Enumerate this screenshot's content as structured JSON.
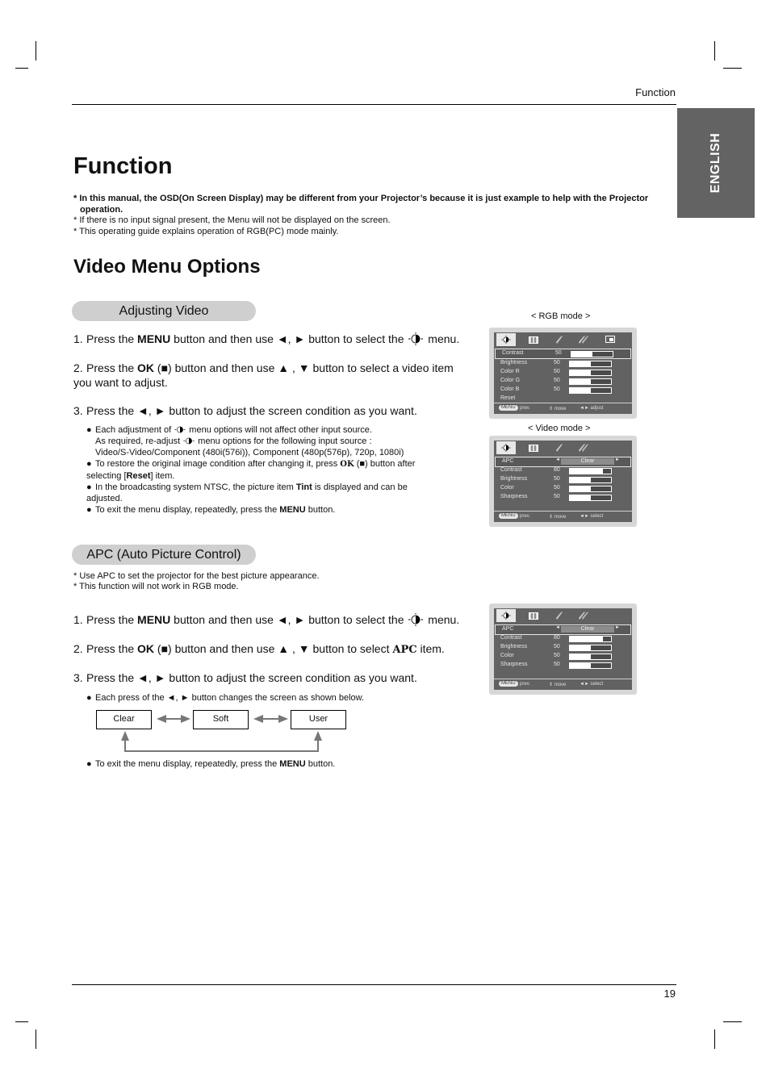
{
  "header": {
    "section_label": "Function"
  },
  "language_tab": "ENGLISH",
  "page_title": "Function",
  "notes": [
    {
      "text": "* In this manual, the OSD(On Screen Display) may be different from your Projector’s because it is just example to help with the Projector operation.",
      "bold": true
    },
    {
      "text": "* If there is no input signal present, the Menu will not be displayed on the screen.",
      "bold": false
    },
    {
      "text": "* This operating guide explains operation of RGB(PC) mode mainly.",
      "bold": false
    }
  ],
  "section_title": "Video Menu Options",
  "adjusting_video": {
    "heading": "Adjusting Video",
    "steps": [
      {
        "num": "1.",
        "pre": "Press the ",
        "bold": "MENU",
        "post": " button and then use ◄, ► button to select the ",
        "post2": " menu."
      },
      {
        "num": "2.",
        "pre": "Press the ",
        "bold": "OK",
        "post": " (■) button and then use ▲ , ▼ button to select a video item you want to adjust."
      },
      {
        "num": "3.",
        "text": "Press the ◄, ► button to adjust the screen condition as you want."
      }
    ],
    "bullets": {
      "b1_a": "Each adjustment of ",
      "b1_b": " menu options will not affect other input source.",
      "b1_c": "As required, re-adjust ",
      "b1_d": " menu options for the following input source :",
      "b1_e": "Video/S-Video/Component (480i(576i)), Component (480p(576p), 720p, 1080i)",
      "b2_a": "To restore the original image condition after changing it, press ",
      "b2_ok": "OK",
      "b2_b": " (■) button after selecting [",
      "b2_reset": "Reset",
      "b2_c": "] item.",
      "b3_a": "In the broadcasting system NTSC, the picture item ",
      "b3_tint": "Tint",
      "b3_b": " is displayed and can be adjusted.",
      "b4_a": "To exit the menu display, repeatedly, press the ",
      "b4_menu": "MENU",
      "b4_b": " button."
    }
  },
  "apc": {
    "heading": "APC (Auto Picture Control)",
    "notes": [
      "* Use APC to set the projector for the best picture appearance.",
      "* This function will not work in RGB mode."
    ],
    "step1_pre": "Press the ",
    "step1_bold": "MENU",
    "step1_post": " button and then use ◄, ► button to select the ",
    "step1_end": " menu.",
    "step2_pre": "Press the ",
    "step2_bold": "OK",
    "step2_mid": " (■) button and then use ▲ , ▼ button to select ",
    "step2_apc": "APC",
    "step2_end": " item.",
    "step3": "Press the ◄, ► button to adjust the screen condition as you want.",
    "bullet1": "Each press of the ◄, ► button changes the screen as shown below.",
    "flow": [
      "Clear",
      "Soft",
      "User"
    ],
    "bullet2_a": "To exit the menu display, repeatedly, press the ",
    "bullet2_menu": "MENU",
    "bullet2_b": " button.",
    "nums": [
      "1.",
      "2.",
      "3."
    ]
  },
  "osd_rgb": {
    "caption": "< RGB mode >",
    "rows": [
      {
        "label": "Contrast",
        "value": "50",
        "level": 0.5,
        "highlight": true
      },
      {
        "label": "Brightness",
        "value": "50",
        "level": 0.5
      },
      {
        "label": "Color R",
        "value": "50",
        "level": 0.5
      },
      {
        "label": "Color G",
        "value": "50",
        "level": 0.5
      },
      {
        "label": "Color B",
        "value": "50",
        "level": 0.5
      },
      {
        "label": "Reset"
      }
    ],
    "footer": {
      "menu": "MENU",
      "prev": "prev.",
      "move": "move",
      "action": "adjust"
    }
  },
  "osd_video": {
    "caption": "< Video mode >",
    "apc_label": "APC",
    "apc_value": "Clear",
    "rows": [
      {
        "label": "Contrast",
        "value": "80",
        "level": 0.8
      },
      {
        "label": "Brightness",
        "value": "50",
        "level": 0.5
      },
      {
        "label": "Color",
        "value": "50",
        "level": 0.5
      },
      {
        "label": "Sharpness",
        "value": "50",
        "level": 0.5
      }
    ],
    "footer": {
      "menu": "MENU",
      "prev": "prev.",
      "move": "move",
      "action": "select"
    }
  },
  "osd_apc": {
    "apc_label": "APC",
    "apc_value": "Clear",
    "rows": [
      {
        "label": "Contrast",
        "value": "80",
        "level": 0.8
      },
      {
        "label": "Brightness",
        "value": "50",
        "level": 0.5
      },
      {
        "label": "Color",
        "value": "50",
        "level": 0.5
      },
      {
        "label": "Sharpness",
        "value": "50",
        "level": 0.5
      }
    ],
    "footer": {
      "menu": "MENU",
      "prev": "prev.",
      "move": "move",
      "action": "select"
    }
  },
  "footer": {
    "page_number": "19"
  }
}
